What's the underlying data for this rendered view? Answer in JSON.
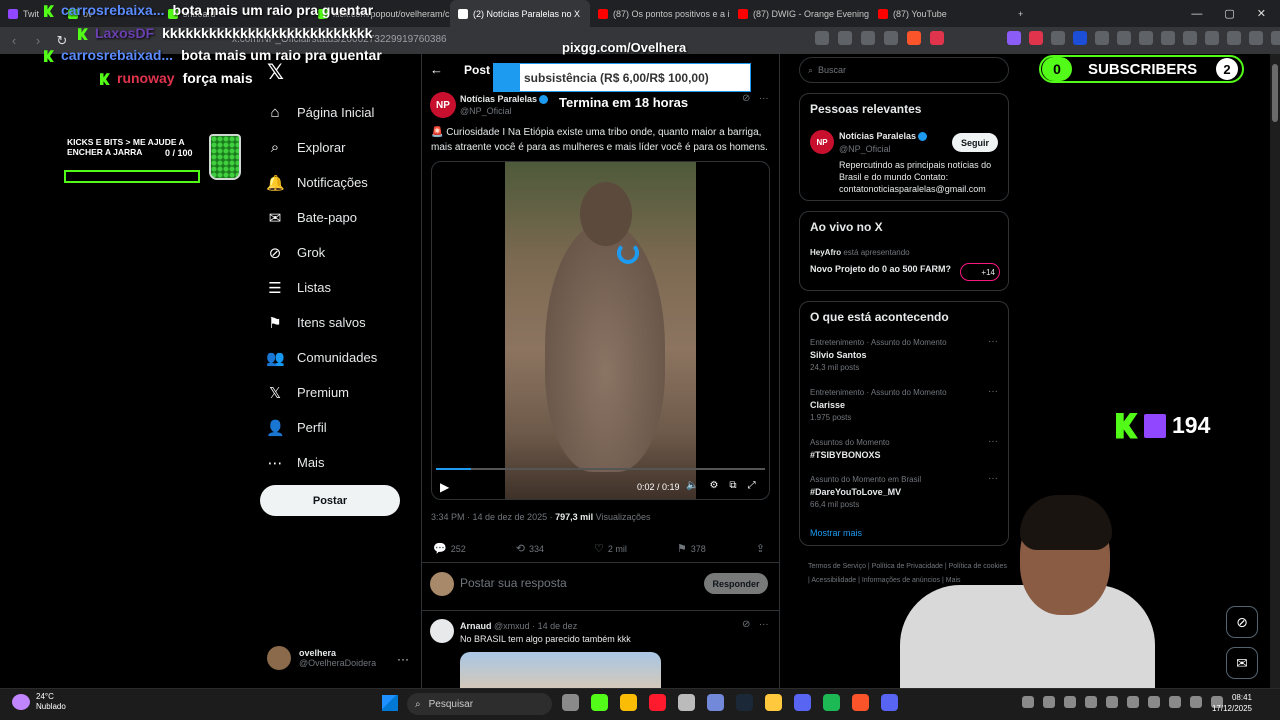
{
  "browser": {
    "tabs": [
      {
        "label": "Twit",
        "color": "#9146ff"
      },
      {
        "label": "ov",
        "color": "#53fc18"
      },
      {
        "label": "shboard",
        "color": "#53fc18"
      },
      {
        "label": "kick.com/popout/ovelheram/ch",
        "color": "#53fc18"
      },
      {
        "label": "(2) Notícias Paralelas no X",
        "color": "#ffffff",
        "active": true
      },
      {
        "label": "(87) Os pontos positivos e a in",
        "color": "#ff0000"
      },
      {
        "label": "(87) DWIG - Orange Evening //",
        "color": "#ff0000"
      },
      {
        "label": "(87) YouTube",
        "color": "#ff0000"
      }
    ],
    "url": "x.com/NP_Oficial/status/2000273229919760386"
  },
  "x_nav": {
    "items": [
      {
        "icon": "⌂",
        "label": "Página Inicial"
      },
      {
        "icon": "⌕",
        "label": "Explorar"
      },
      {
        "icon": "🔔",
        "label": "Notificações"
      },
      {
        "icon": "✉",
        "label": "Bate-papo"
      },
      {
        "icon": "⊘",
        "label": "Grok"
      },
      {
        "icon": "☰",
        "label": "Listas"
      },
      {
        "icon": "⚑",
        "label": "Itens salvos"
      },
      {
        "icon": "👥",
        "label": "Comunidades"
      },
      {
        "icon": "𝕏",
        "label": "Premium"
      },
      {
        "icon": "👤",
        "label": "Perfil"
      },
      {
        "icon": "⋯",
        "label": "Mais"
      }
    ],
    "post_button": "Postar",
    "account": {
      "name": "ovelhera",
      "handle": "@OvelheraDoidera"
    }
  },
  "post": {
    "header": "Post",
    "author": "Notícias Paralelas",
    "handle": "@NP_Oficial",
    "avatar_text": "NP",
    "text": "🚨 Curiosidade I Na Etiópia existe uma tribo onde, quanto maior a barriga, mais atraente você é para as mulheres e mais líder você é para os homens.",
    "video": {
      "time": "0:02 / 0:19",
      "progress": 0.105
    },
    "meta_time": "3:34 PM · 14 de dez de 2025 · ",
    "views": "797,3 mil",
    "views_label": " Visualizações",
    "stats": {
      "replies": "252",
      "reposts": "334",
      "likes": "2 mil",
      "bookmarks": "378"
    },
    "reply_placeholder": "Postar sua resposta",
    "reply_button": "Responder"
  },
  "comment": {
    "name": "Arnaud",
    "handle": "@xmxud · 14 de dez",
    "text": "No BRASIL tem algo parecido também kkk"
  },
  "sidebar": {
    "search_placeholder": "Buscar",
    "relevant": {
      "title": "Pessoas relevantes",
      "name": "Notícias Paralelas",
      "handle": "@NP_Oficial",
      "follow": "Seguir",
      "bio": "Repercutindo as principais notícias do Brasil e do mundo Contato: contatonoticiasparalelas@gmail.com"
    },
    "live": {
      "title": "Ao vivo no X",
      "host": "HeyAfro",
      "host_suffix": " está apresentando",
      "stream_title": "Novo Projeto do 0 ao 500 FARM?",
      "badge": "+14"
    },
    "trending": {
      "title": "O que está acontecendo",
      "items": [
        {
          "context": "Entretenimento · Assunto do Momento",
          "topic": "Silvio Santos",
          "posts": "24,3 mil posts"
        },
        {
          "context": "Entretenimento · Assunto do Momento",
          "topic": "Clarisse",
          "posts": "1.975 posts"
        },
        {
          "context": "Assuntos do Momento",
          "topic": "#TSIBYBONOXS",
          "posts": ""
        },
        {
          "context": "Assunto do Momento em Brasil",
          "topic": "#DareYouToLove_MV",
          "posts": "66,4 mil posts"
        }
      ],
      "show_more": "Mostrar mais"
    },
    "footer": "Termos de Serviço  |  Política de Privacidade  |  Política de cookies  |  Acessibilidade  |  Informações de anúncios  |  Mais"
  },
  "overlay": {
    "chat": [
      {
        "user": "carrosrebaixa...",
        "user_color": "#5b8cff",
        "msg": "bota mais um raio pra guentar"
      },
      {
        "user": "LaxosDF",
        "user_color": "#6a3fb0",
        "msg": "kkkkkkkkkkkkkkkkkkkkkkkkkkk"
      },
      {
        "user": "carrosrebaixad...",
        "user_color": "#5b8cff",
        "msg": "bota mais um raio pra guentar"
      },
      {
        "user": "runoway",
        "user_color": "#e0344c",
        "msg": "força mais"
      }
    ],
    "pixgg": "pixgg.com/Ovelhera",
    "goal_text": "subsistência (R$ 6,00/R$ 100,00)",
    "goal_progress": 0.06,
    "timer": "Termina em 18 horas",
    "jar_label": "KICKS E BITS > ME AJUDE A ENCHER A JARRA",
    "jar_count": "0  / 100",
    "jar_progress": 0,
    "subscribers_left": "0",
    "subscribers_label": "SUBSCRIBERS",
    "subscribers_right": "2",
    "viewers": "194"
  },
  "taskbar": {
    "temp": "24°C",
    "weather": "Nublado",
    "search": "Pesquisar",
    "time": "08:41",
    "date": "17/12/2025",
    "app_colors": [
      "#8a8a8a",
      "#53fc18",
      "#fbbc05",
      "#ff1b2d",
      "#bbbbbb",
      "#7289da",
      "#1b2838",
      "#ffc83d",
      "#5865f2",
      "#1db954",
      "#fb542b",
      "#5865f2"
    ]
  },
  "colors": {
    "accent": "#1d9bf0",
    "kick_green": "#53fc18",
    "twitch_purple": "#9146ff"
  }
}
